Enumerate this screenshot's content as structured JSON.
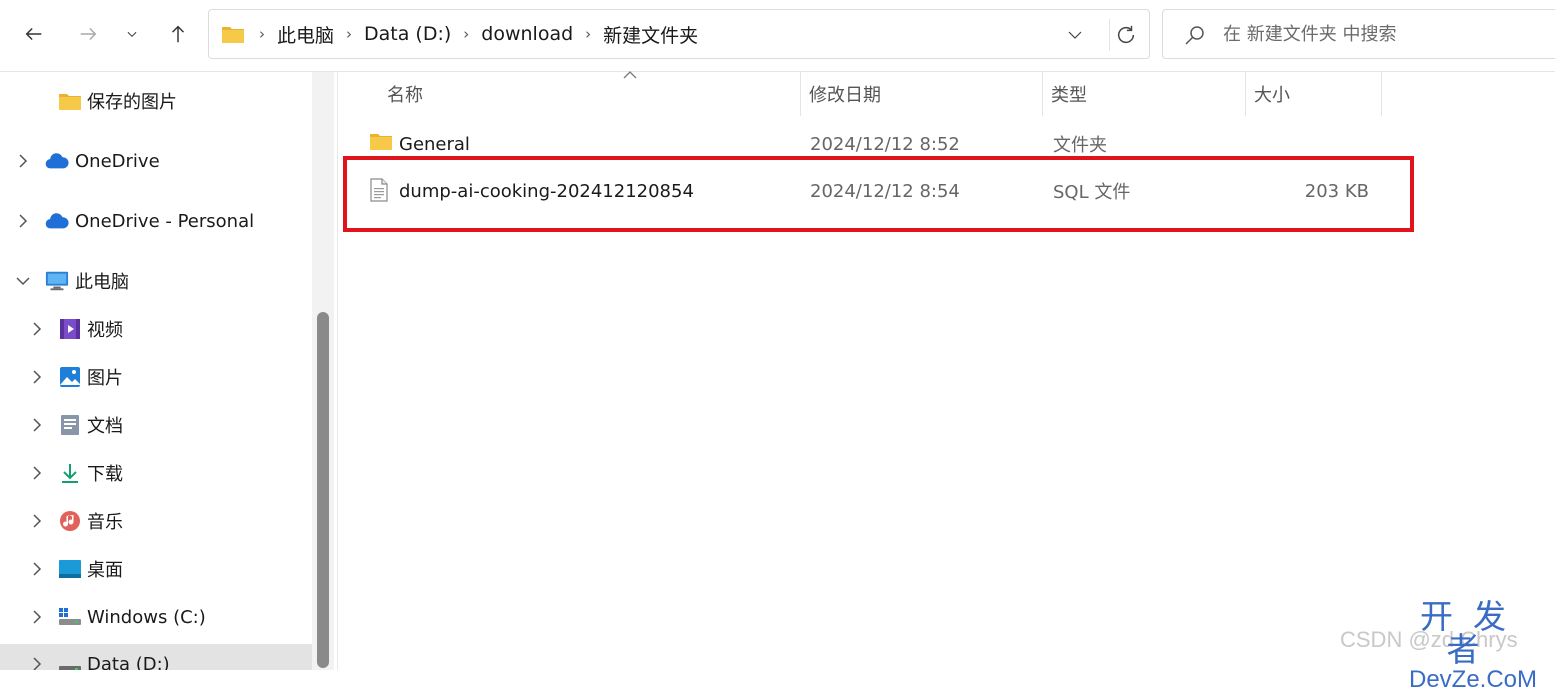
{
  "toolbar": {
    "back_icon": "arrow-left-icon",
    "forward_icon": "arrow-right-icon",
    "recent_icon": "chevron-down-icon",
    "up_icon": "arrow-up-icon"
  },
  "address": {
    "crumbs": [
      "此电脑",
      "Data (D:)",
      "download",
      "新建文件夹"
    ]
  },
  "search": {
    "placeholder": "在 新建文件夹 中搜索"
  },
  "sidebar": {
    "items": [
      {
        "label": "保存的图片",
        "icon": "folder-icon"
      },
      {
        "label": "OneDrive",
        "icon": "cloud-icon"
      },
      {
        "label": "OneDrive - Personal",
        "icon": "cloud-icon"
      },
      {
        "label": "此电脑",
        "icon": "monitor-icon"
      },
      {
        "label": "视频",
        "icon": "video-icon"
      },
      {
        "label": "图片",
        "icon": "pictures-icon"
      },
      {
        "label": "文档",
        "icon": "document-icon"
      },
      {
        "label": "下载",
        "icon": "download-icon"
      },
      {
        "label": "音乐",
        "icon": "music-icon"
      },
      {
        "label": "桌面",
        "icon": "desktop-icon"
      },
      {
        "label": "Windows (C:)",
        "icon": "drive-icon"
      },
      {
        "label": "Data (D:)",
        "icon": "drive-icon"
      }
    ]
  },
  "columns": {
    "name": "名称",
    "modified": "修改日期",
    "type": "类型",
    "size": "大小"
  },
  "files": [
    {
      "name": "General",
      "modified": "2024/12/12 8:52",
      "type": "文件夹",
      "size": "",
      "icon": "folder-icon"
    },
    {
      "name": "dump-ai-cooking-202412120854",
      "modified": "2024/12/12 8:54",
      "type": "SQL 文件",
      "size": "203 KB",
      "icon": "file-icon"
    }
  ],
  "colors": {
    "highlight": "#e0141c",
    "folder": "#f7c948",
    "onedrive": "#1f6fd6"
  },
  "watermark": {
    "csdn": "CSDN @zd Chrys",
    "cn": "开发者",
    "en": "DevZe.CoM"
  }
}
